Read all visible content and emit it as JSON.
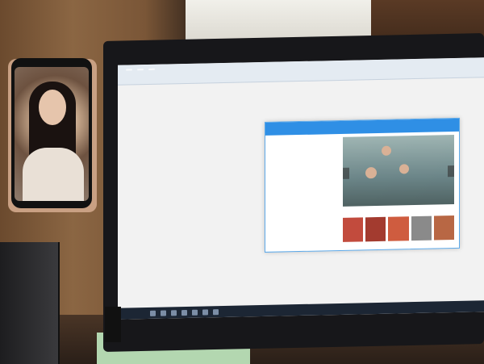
{
  "browser": {
    "tabs": [
      "",
      "",
      ""
    ],
    "sidebar_items": [
      "",
      "",
      "",
      "",
      "",
      "",
      "",
      "",
      "",
      "",
      "",
      "",
      "",
      "",
      "",
      "",
      ""
    ]
  },
  "popup": {
    "header_title": "",
    "header_links": [
      "",
      "",
      ""
    ],
    "article_lines": [
      "",
      "",
      "",
      "",
      "",
      "",
      "",
      "",
      "",
      "",
      "",
      "",
      "",
      "",
      "",
      ""
    ],
    "caption": ""
  },
  "taskbar": {
    "icons": [
      "",
      "",
      "",
      "",
      "",
      "",
      ""
    ]
  },
  "colors": {
    "accent": "#2f8fe5",
    "taskbar": "#1c2634"
  }
}
